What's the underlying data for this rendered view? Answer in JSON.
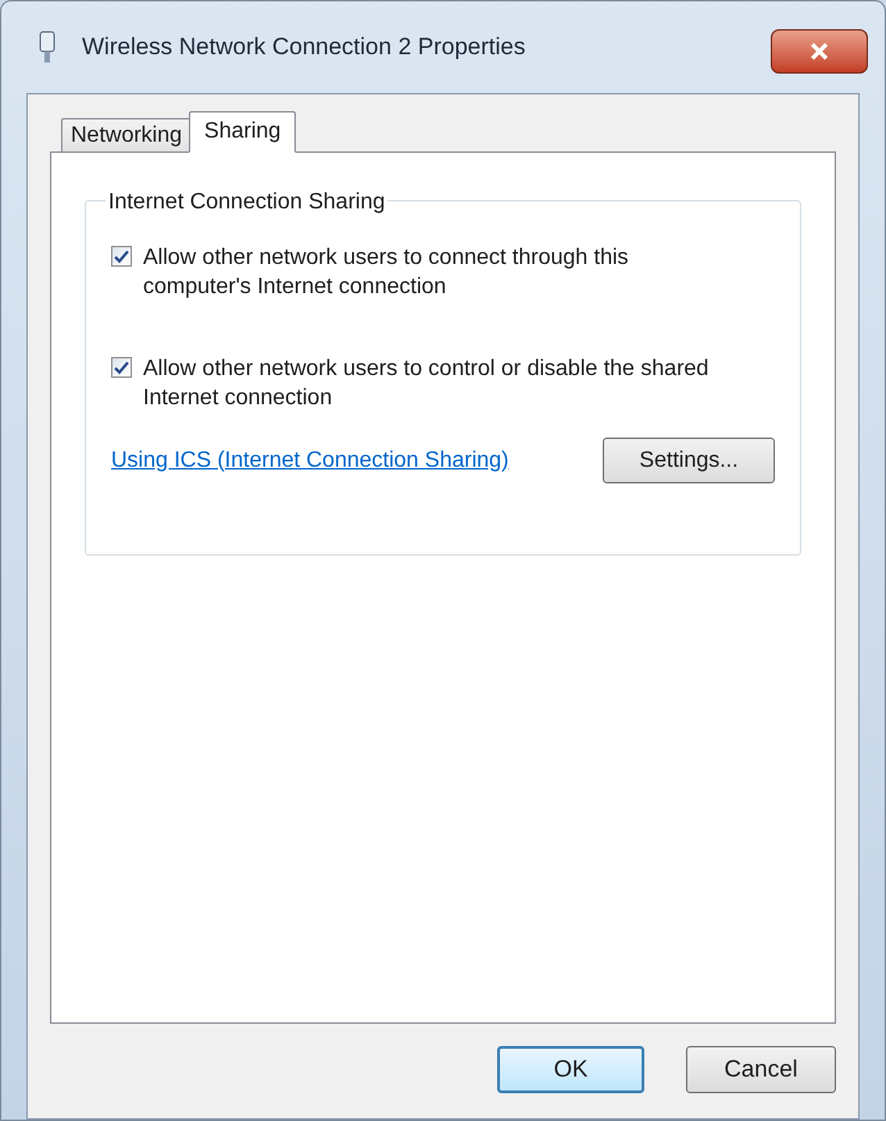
{
  "window": {
    "title": "Wireless Network Connection 2 Properties"
  },
  "tabs": [
    {
      "label": "Networking",
      "selected": false
    },
    {
      "label": "Sharing",
      "selected": true
    }
  ],
  "group": {
    "title": "Internet Connection Sharing",
    "options": [
      {
        "label": "Allow other network users to connect through this computer's Internet connection",
        "checked": true
      },
      {
        "label": "Allow other network users to control or disable the shared Internet connection",
        "checked": true
      }
    ],
    "link": "Using ICS (Internet Connection Sharing)",
    "settings_button": "Settings..."
  },
  "buttons": [
    {
      "label": "OK",
      "default": true
    },
    {
      "label": "Cancel",
      "default": false
    }
  ]
}
